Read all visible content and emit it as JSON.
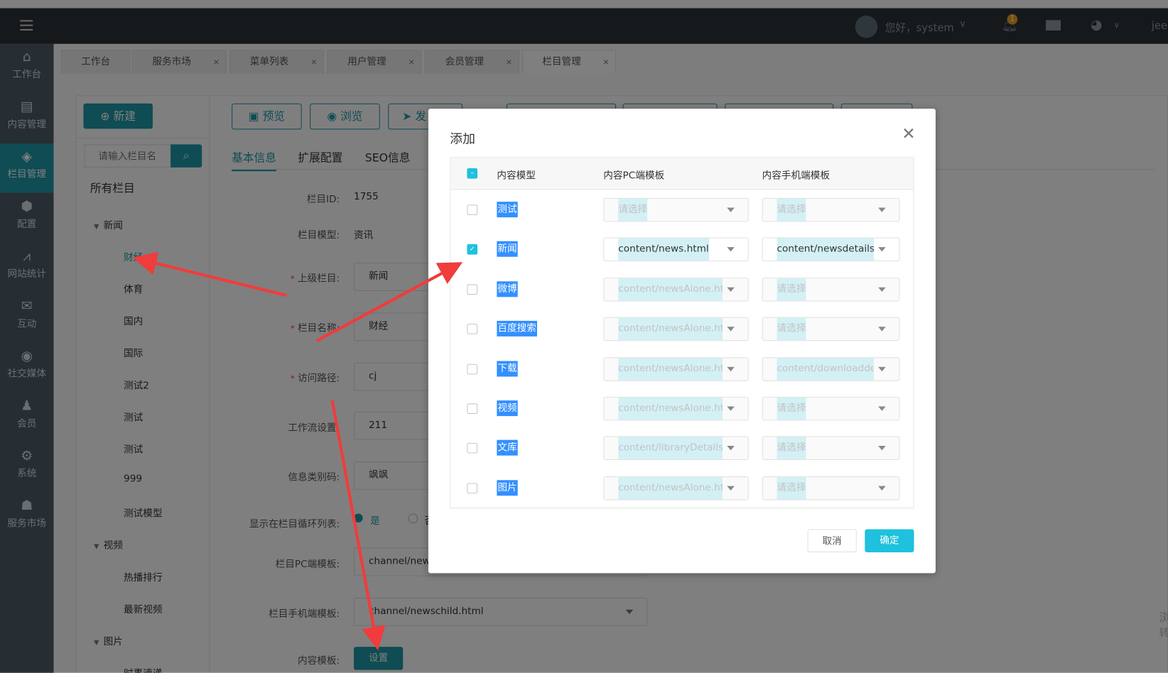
{
  "topbar": {
    "greeting": "您好，system",
    "notification_count": "1",
    "user_short": "jeec"
  },
  "sidebar": {
    "items": [
      {
        "label": "工作台",
        "icon": "home-icon",
        "glyph": "⌂"
      },
      {
        "label": "内容管理",
        "icon": "document-icon",
        "glyph": "▤"
      },
      {
        "label": "栏目管理",
        "icon": "layers-icon",
        "glyph": "◈",
        "active": true
      },
      {
        "label": "配置",
        "icon": "cube-icon",
        "glyph": "⬢"
      },
      {
        "label": "网站统计",
        "icon": "chart-icon",
        "glyph": "⩘"
      },
      {
        "label": "互动",
        "icon": "chat-icon",
        "glyph": "✉"
      },
      {
        "label": "社交媒体",
        "icon": "target-icon",
        "glyph": "◉"
      },
      {
        "label": "会员",
        "icon": "user-icon",
        "glyph": "♟"
      },
      {
        "label": "系统",
        "icon": "gear-icon",
        "glyph": "⚙"
      },
      {
        "label": "服务市场",
        "icon": "person-icon",
        "glyph": "☗"
      }
    ]
  },
  "tabs": [
    {
      "label": "工作台",
      "closable": false
    },
    {
      "label": "服务市场",
      "closable": true
    },
    {
      "label": "菜单列表",
      "closable": true
    },
    {
      "label": "用户管理",
      "closable": true
    },
    {
      "label": "会员管理",
      "closable": true
    },
    {
      "label": "栏目管理",
      "closable": true,
      "active": true
    }
  ],
  "close_glyph": "×",
  "left_panel": {
    "new_button": "新建",
    "search_placeholder": "请输入栏目名",
    "tree_root": "所有栏目",
    "tree": [
      {
        "label": "新闻",
        "level": 0
      },
      {
        "label": "财经",
        "level": 1,
        "selected": true
      },
      {
        "label": "体育",
        "level": 1
      },
      {
        "label": "国内",
        "level": 1
      },
      {
        "label": "国际",
        "level": 1
      },
      {
        "label": "测试2",
        "level": 1
      },
      {
        "label": "测试",
        "level": 1
      },
      {
        "label": "测试",
        "level": 1
      },
      {
        "label": "999",
        "level": 1
      },
      {
        "label": "测试模型",
        "level": 1
      },
      {
        "label": "视频",
        "level": 0
      },
      {
        "label": "热播排行",
        "level": 1
      },
      {
        "label": "最新视频",
        "level": 1
      },
      {
        "label": "图片",
        "level": 0
      },
      {
        "label": "时事速递",
        "level": 1
      }
    ]
  },
  "toolbar": {
    "preview": "预览",
    "browse": "浏览",
    "publish": "发"
  },
  "form_tabs": [
    "基本信息",
    "扩展配置",
    "SEO信息"
  ],
  "form": {
    "id_label": "栏目ID:",
    "id_value": "1755",
    "model_label": "栏目模型:",
    "model_value": "资讯",
    "parent_label": "上级栏目:",
    "parent_value": "新闻",
    "name_label": "栏目名称:",
    "name_value": "财经",
    "path_label": "访问路径:",
    "path_value": "cj",
    "workflow_label": "工作流设置:",
    "workflow_value": "211",
    "code_label": "信息类别码:",
    "code_value": "飒飒",
    "loop_label": "显示在栏目循环列表:",
    "loop_yes": "是",
    "loop_no": "否",
    "pc_label": "栏目PC端模板:",
    "pc_value": "channel/newschild.html",
    "mobile_label": "栏目手机端模板:",
    "mobile_value": "channel/newschild.html",
    "content_label": "内容模板:",
    "content_button": "设置"
  },
  "side_hint": [
    "浏",
    "转"
  ],
  "modal": {
    "title": "添加",
    "headers": [
      "内容模型",
      "内容PC端模板",
      "内容手机端模板"
    ],
    "rows": [
      {
        "name": "测试",
        "checked": false,
        "pc": "请选择",
        "mobile": "请选择"
      },
      {
        "name": "新闻",
        "checked": true,
        "pc": "content/news.html",
        "mobile": "content/newsdetails.html"
      },
      {
        "name": "微博",
        "checked": false,
        "pc": "content/newsAlone.html",
        "mobile": "请选择"
      },
      {
        "name": "百度搜索",
        "checked": false,
        "pc": "content/newsAlone.html",
        "mobile": "请选择"
      },
      {
        "name": "下载",
        "checked": false,
        "pc": "content/newsAlone.html",
        "mobile": "content/downloaddetails.html"
      },
      {
        "name": "视频",
        "checked": false,
        "pc": "content/newsAlone.html",
        "mobile": "请选择"
      },
      {
        "name": "文库",
        "checked": false,
        "pc": "content/libraryDetails.html",
        "mobile": "请选择"
      },
      {
        "name": "图片",
        "checked": false,
        "pc": "content/newsAlone.html",
        "mobile": "请选择"
      }
    ],
    "cancel": "取消",
    "confirm": "确定"
  },
  "colors": {
    "accent": "#1f98a8",
    "confirm": "#1fc1de",
    "selection": "#3390ff",
    "annotation": "#f03c3c"
  }
}
